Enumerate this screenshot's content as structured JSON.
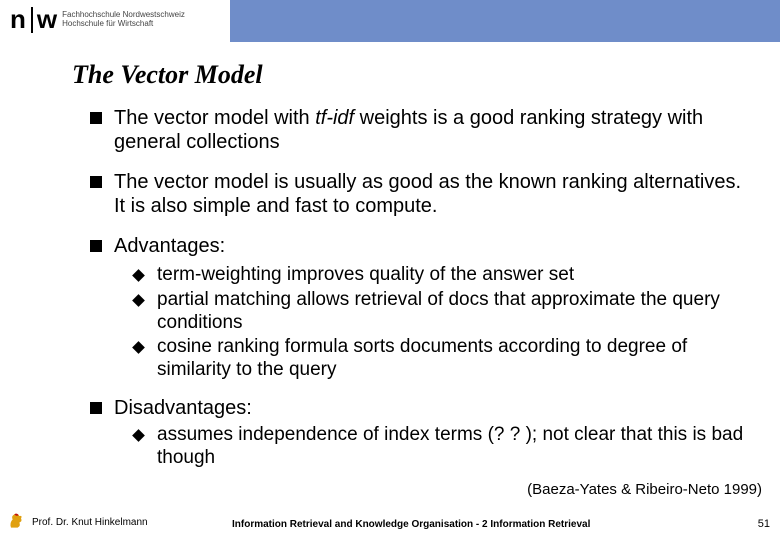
{
  "header": {
    "logo_mark": "n|w",
    "logo_line1": "Fachhochschule Nordwestschweiz",
    "logo_line2": "Hochschule für Wirtschaft"
  },
  "title": "The Vector Model",
  "bullets": [
    {
      "pre": "The vector model with ",
      "em": "tf-idf",
      "post": " weights is a good ranking strategy with general collections"
    },
    {
      "text": "The vector model is usually as good as the known ranking alternatives. It is also simple and fast to compute."
    },
    {
      "text": "Advantages:",
      "sub": [
        "term-weighting improves quality of the answer set",
        "partial matching allows retrieval of docs that approximate the query conditions",
        "cosine ranking formula sorts documents according to degree of similarity to the query"
      ]
    },
    {
      "text": "Disadvantages:",
      "sub": [
        "assumes independence of index terms (? ? ); not clear that this is bad though"
      ]
    }
  ],
  "citation": "(Baeza-Yates & Ribeiro-Neto 1999)",
  "footer": {
    "author": "Prof. Dr. Knut Hinkelmann",
    "title": "Information Retrieval and Knowledge Organisation - 2 Information Retrieval",
    "page": "51"
  }
}
